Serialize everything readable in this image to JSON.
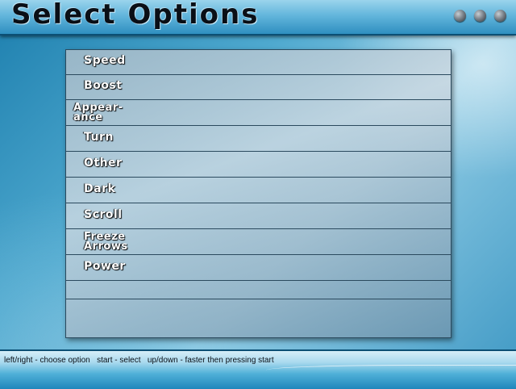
{
  "header": {
    "title": "Select Options"
  },
  "window_controls": [
    "circle-button",
    "circle-button",
    "circle-button"
  ],
  "options": [
    {
      "label": "Speed"
    },
    {
      "label": "Boost"
    },
    {
      "label": "Appear-\nance"
    },
    {
      "label": "Turn"
    },
    {
      "label": "Other"
    },
    {
      "label": "Dark"
    },
    {
      "label": "Scroll"
    },
    {
      "label": "Freeze\nArrows"
    },
    {
      "label": "Power"
    },
    {
      "label": ""
    }
  ],
  "footer": {
    "help": "left/right - choose option   start - select   up/down - faster then pressing start"
  }
}
